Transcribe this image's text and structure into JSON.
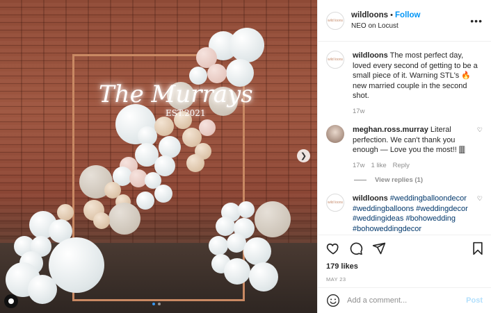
{
  "post": {
    "account": "wildloons",
    "follow_label": "Follow",
    "separator": "•",
    "location": "NEO on Locust",
    "more_icon": "more-horizontal-icon",
    "avatar_text": "wild loons"
  },
  "photo": {
    "neon_title": "The Murrays",
    "neon_sub": "EST.2021",
    "next_icon": "chevron-right-icon",
    "carousel_dots": 2,
    "carousel_active": 1
  },
  "caption": {
    "user": "wildloons",
    "text_before": "The most perfect day, loved every second of getting to be a small piece of it. Warning STL's ",
    "emoji": "🔥",
    "text_after": "new married couple in the second shot.",
    "time": "17w"
  },
  "comment": {
    "user": "meghan.ross.murray",
    "text": "Literal perfection. We can't thank you enough — Love you the most!! 🀫",
    "time": "17w",
    "likes": "1 like",
    "reply": "Reply",
    "view_replies": "View replies (1)"
  },
  "hashtag_comment": {
    "user": "wildloons",
    "tags": [
      "#weddingballoondecor",
      "#weddingballoons",
      "#weddingdecor",
      "#weddingideas",
      "#bohowedding",
      "#bohoweddingdecor"
    ]
  },
  "footer": {
    "likes": "179 likes",
    "date": "MAY 23",
    "comment_placeholder": "Add a comment...",
    "post_label": "Post"
  },
  "colors": {
    "accent": "#0095f6",
    "post_disabled": "#b2dffc",
    "muted": "#8e8e8e",
    "hashtag": "#00376b"
  }
}
